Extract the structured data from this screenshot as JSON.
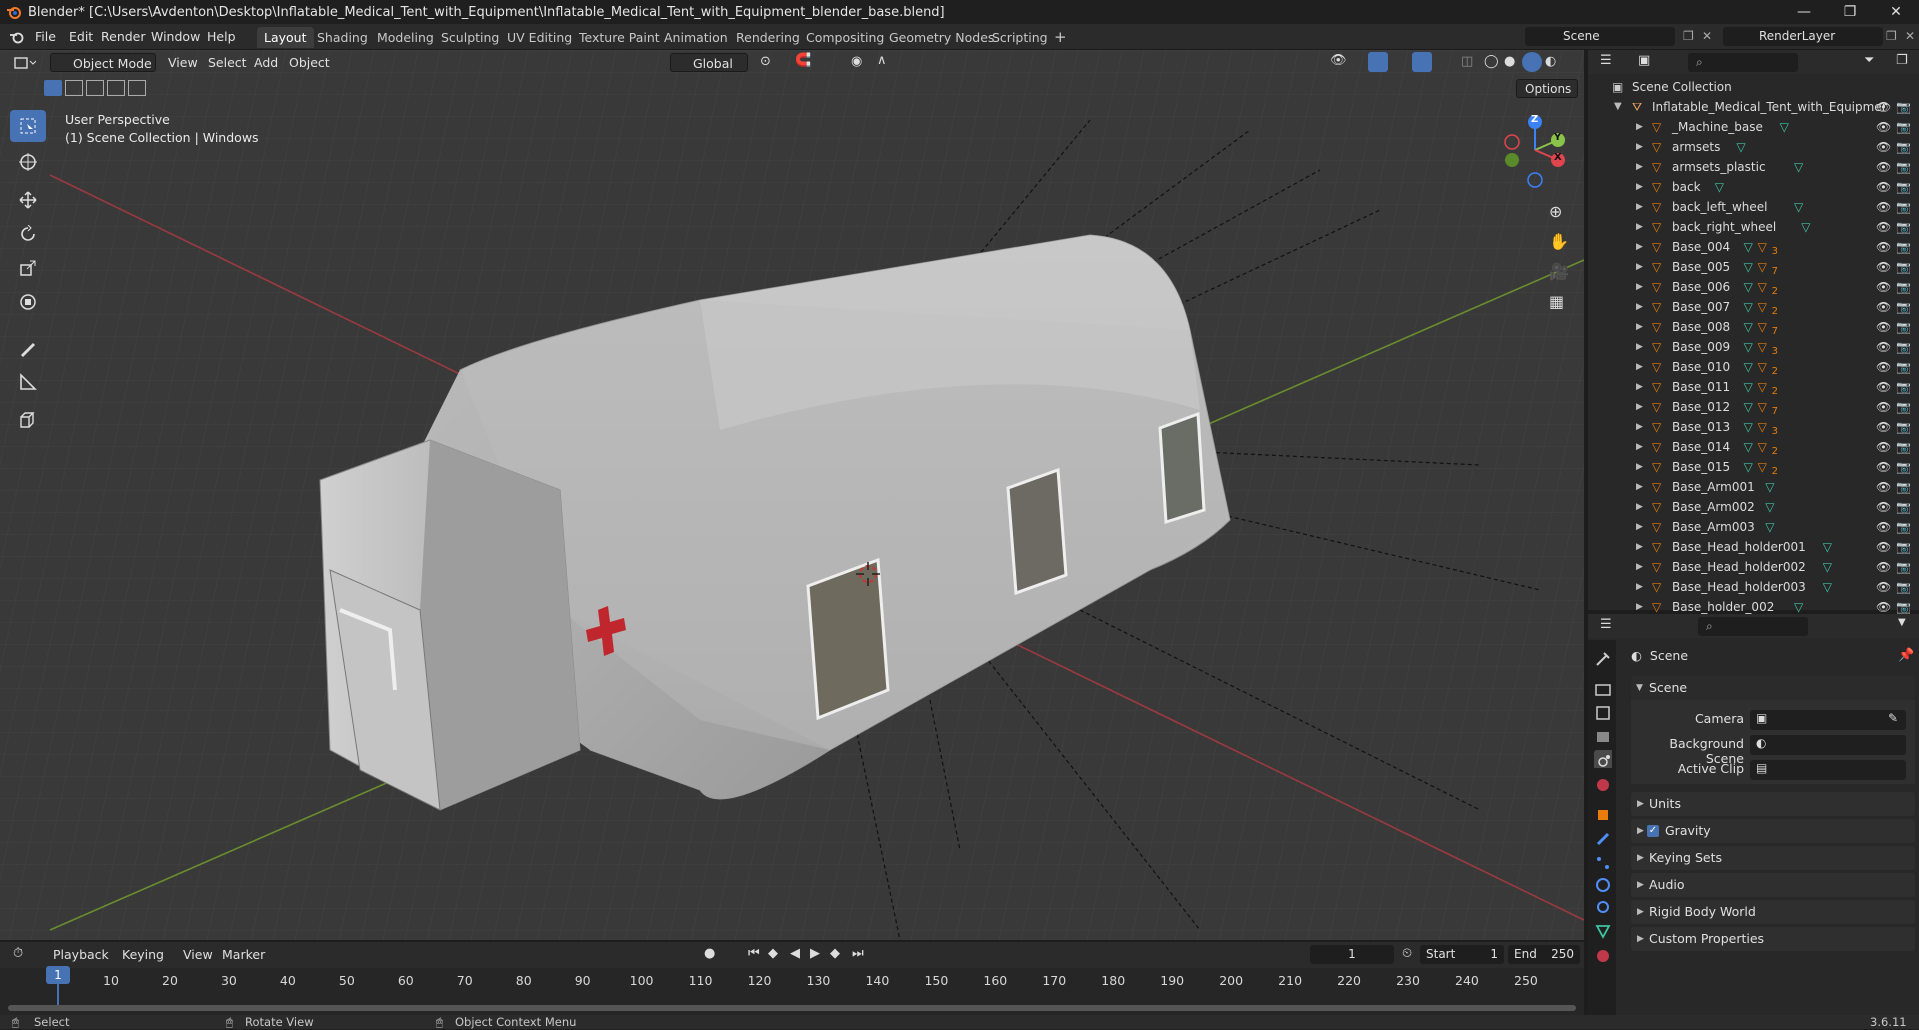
{
  "window": {
    "title": "Blender* [C:\\Users\\Avdenton\\Desktop\\Inflatable_Medical_Tent_with_Equipment\\Inflatable_Medical_Tent_with_Equipment_blender_base.blend]",
    "minimize": "—",
    "maximize": "❐",
    "close": "✕"
  },
  "menu": [
    "File",
    "Edit",
    "Render",
    "Window",
    "Help"
  ],
  "workspaces": [
    "Layout",
    "Shading",
    "Modeling",
    "Sculpting",
    "UV Editing",
    "Texture Paint",
    "Animation",
    "Rendering",
    "Compositing",
    "Geometry Nodes",
    "Scripting"
  ],
  "active_workspace": "Layout",
  "scene_field": "Scene",
  "view_layer_field": "RenderLayer",
  "viewport": {
    "mode": "Object Mode",
    "menus": [
      "View",
      "Select",
      "Add",
      "Object"
    ],
    "transform_orientation": "Global",
    "options": "Options",
    "info_line1": "User Perspective",
    "info_line2": "(1) Scene Collection | Windows",
    "gizmo": {
      "z": "Z",
      "y": "Y",
      "x": "X"
    }
  },
  "outliner": {
    "root": "Scene Collection",
    "collection": "Inflatable_Medical_Tent_with_Equipmer",
    "items": [
      {
        "name": "_Machine_base",
        "badge": ""
      },
      {
        "name": "armsets",
        "badge": ""
      },
      {
        "name": "armsets_plastic",
        "badge": ""
      },
      {
        "name": "back",
        "badge": ""
      },
      {
        "name": "back_left_wheel",
        "badge": ""
      },
      {
        "name": "back_right_wheel",
        "badge": ""
      },
      {
        "name": "Base_004",
        "badge": "3"
      },
      {
        "name": "Base_005",
        "badge": "7"
      },
      {
        "name": "Base_006",
        "badge": "2"
      },
      {
        "name": "Base_007",
        "badge": "2"
      },
      {
        "name": "Base_008",
        "badge": "7"
      },
      {
        "name": "Base_009",
        "badge": "3"
      },
      {
        "name": "Base_010",
        "badge": "2"
      },
      {
        "name": "Base_011",
        "badge": "2"
      },
      {
        "name": "Base_012",
        "badge": "7"
      },
      {
        "name": "Base_013",
        "badge": "3"
      },
      {
        "name": "Base_014",
        "badge": "2"
      },
      {
        "name": "Base_015",
        "badge": "2"
      },
      {
        "name": "Base_Arm001",
        "badge": ""
      },
      {
        "name": "Base_Arm002",
        "badge": ""
      },
      {
        "name": "Base_Arm003",
        "badge": ""
      },
      {
        "name": "Base_Head_holder001",
        "badge": ""
      },
      {
        "name": "Base_Head_holder002",
        "badge": ""
      },
      {
        "name": "Base_Head_holder003",
        "badge": ""
      },
      {
        "name": "Base_holder_002",
        "badge": ""
      }
    ]
  },
  "properties": {
    "context": "Scene",
    "panel": "Scene",
    "camera_label": "Camera",
    "background_label": "Background Scene",
    "clip_label": "Active Clip",
    "sections": [
      "Units",
      "Gravity",
      "Keying Sets",
      "Audio",
      "Rigid Body World",
      "Custom Properties"
    ],
    "gravity_checked": true
  },
  "timeline": {
    "menus": [
      "Playback",
      "Keying",
      "View",
      "Marker"
    ],
    "current_frame": "1",
    "start_label": "Start",
    "start": "1",
    "end_label": "End",
    "end": "250",
    "ruler": [
      "1",
      "10",
      "20",
      "30",
      "40",
      "50",
      "60",
      "70",
      "80",
      "90",
      "100",
      "110",
      "120",
      "130",
      "140",
      "150",
      "160",
      "170",
      "180",
      "190",
      "200",
      "210",
      "220",
      "230",
      "240",
      "250"
    ]
  },
  "statusbar": {
    "select": "Select",
    "rotate": "Rotate View",
    "context": "Object Context Menu",
    "version": "3.6.11"
  },
  "colors": {
    "accent": "#4772b3",
    "x_axis": "#e0454d",
    "y_axis": "#8bc34a",
    "z_axis": "#3b82f6",
    "object_orange": "#e87d0d",
    "mesh_green": "#3ec5a0"
  }
}
